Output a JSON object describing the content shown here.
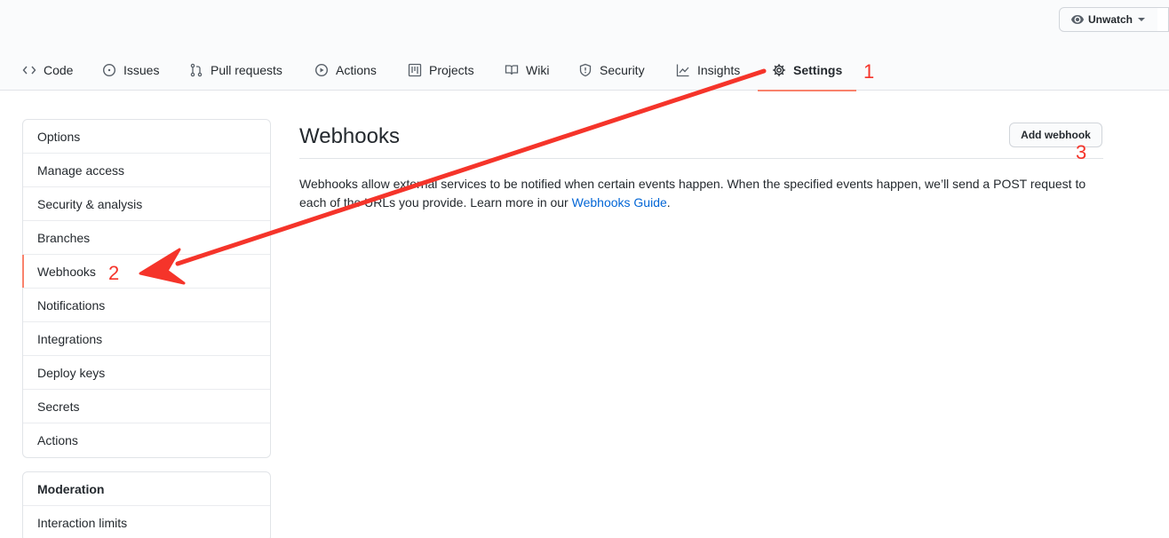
{
  "header": {
    "watch_label": "Unwatch"
  },
  "tabs": [
    {
      "label": "Code",
      "icon": "code-icon"
    },
    {
      "label": "Issues",
      "icon": "issue-icon"
    },
    {
      "label": "Pull requests",
      "icon": "pull-request-icon"
    },
    {
      "label": "Actions",
      "icon": "play-icon"
    },
    {
      "label": "Projects",
      "icon": "project-icon"
    },
    {
      "label": "Wiki",
      "icon": "book-icon"
    },
    {
      "label": "Security",
      "icon": "shield-icon"
    },
    {
      "label": "Insights",
      "icon": "graph-icon"
    },
    {
      "label": "Settings",
      "icon": "gear-icon",
      "selected": true
    }
  ],
  "sidebar": {
    "items": [
      {
        "label": "Options"
      },
      {
        "label": "Manage access"
      },
      {
        "label": "Security & analysis"
      },
      {
        "label": "Branches"
      },
      {
        "label": "Webhooks",
        "selected": true
      },
      {
        "label": "Notifications"
      },
      {
        "label": "Integrations"
      },
      {
        "label": "Deploy keys"
      },
      {
        "label": "Secrets"
      },
      {
        "label": "Actions"
      }
    ],
    "moderation": {
      "heading": "Moderation",
      "items": [
        {
          "label": "Interaction limits"
        }
      ]
    }
  },
  "main": {
    "title": "Webhooks",
    "add_button": "Add webhook",
    "description_before": "Webhooks allow external services to be notified when certain events happen. When the specified events happen, we’ll send a POST request to each of the URLs you provide. Learn more in our ",
    "link_text": "Webhooks Guide",
    "description_after": "."
  },
  "annotations": {
    "step1": "1",
    "step2": "2",
    "step3": "3",
    "color": "#f5342a"
  }
}
